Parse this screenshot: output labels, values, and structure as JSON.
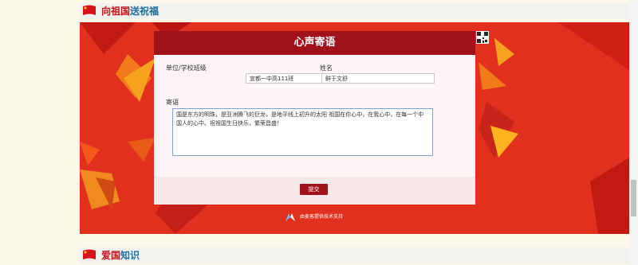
{
  "sections": {
    "top": {
      "title_red": "向祖国",
      "title_blue": "送祝福"
    },
    "bottom": {
      "title_red": "爱国",
      "title_blue": "知识"
    }
  },
  "card": {
    "title": "心声寄语",
    "unit_label": "单位/学校班级",
    "unit_value": "宣都一中高111班",
    "name_label": "姓名",
    "name_value": "鲜于文舒",
    "message_label": "寄语",
    "message_value": "国是东方的明珠，是亚洲腾飞的巨龙，是地平线上初升的太阳 祖国在你心中，在我心中，在每一个中国人的心中。祝祖国生日快乐，繁荣昌盛！",
    "submit_label": "提交"
  },
  "support_text": "由麦客提供技术支持",
  "colors": {
    "accent": "#a1111b",
    "banner": "#e2301f",
    "blue": "#1c6f9c"
  }
}
